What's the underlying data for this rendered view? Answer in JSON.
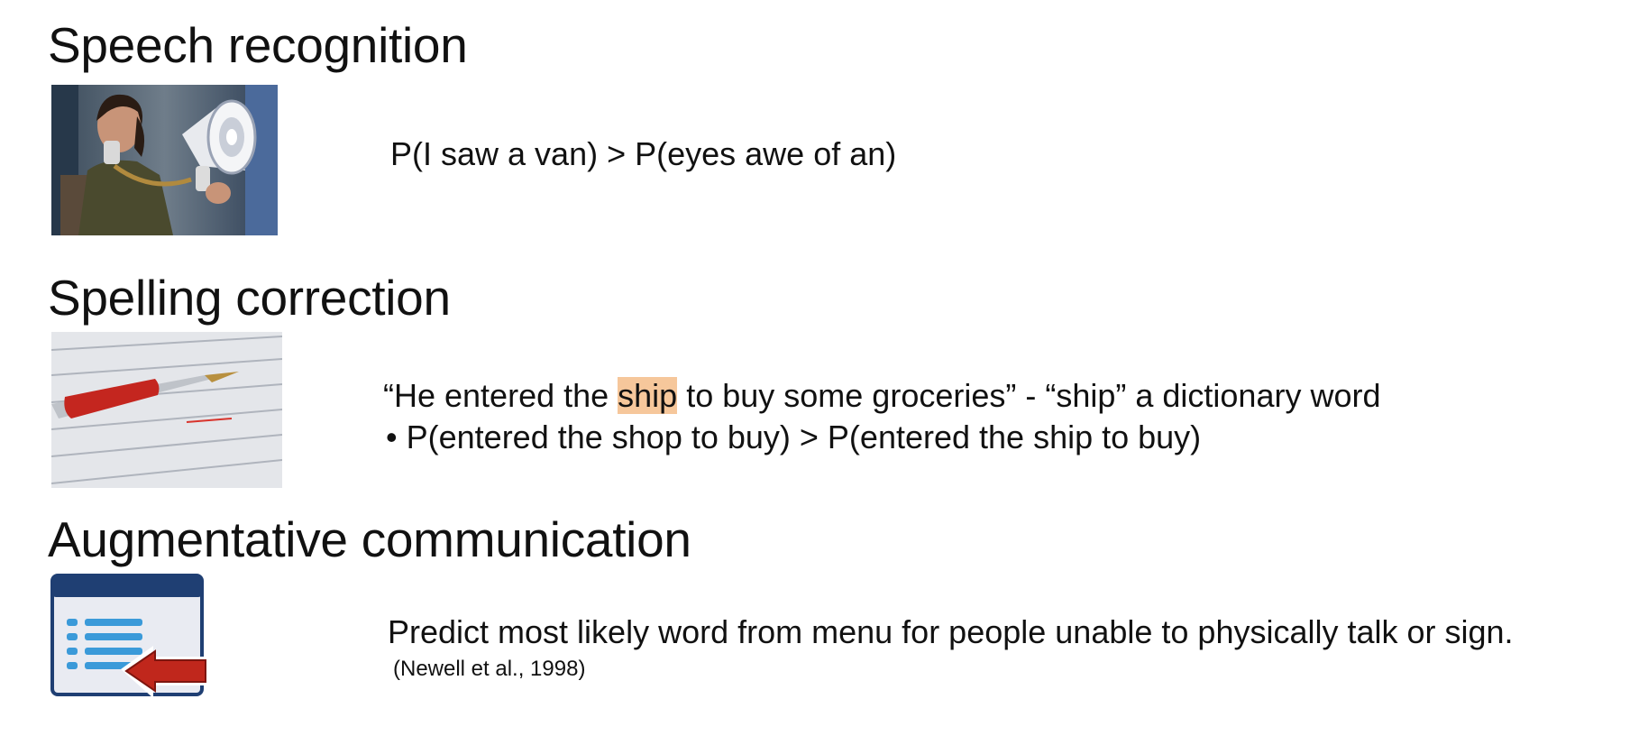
{
  "sections": [
    {
      "heading": "Speech recognition",
      "image_icon": "megaphone-photo",
      "text": "P(I saw a van) > P(eyes awe of an)"
    },
    {
      "heading": "Spelling correction",
      "image_icon": "red-pen-proofreading-photo",
      "line1_before": "“He entered the ",
      "line1_highlight": "ship",
      "line1_after": " to buy some groceries” - “ship” a dictionary word",
      "bullet_char": "•",
      "bullet_text": "P(entered the shop to buy) > P(entered the ship to buy)"
    },
    {
      "heading": "Augmentative communication",
      "image_icon": "menu-list-arrow-icon",
      "text": "Predict most likely word from menu for people unable to physically talk or sign.",
      "citation": "(Newell et al., 1998)"
    }
  ],
  "colors": {
    "highlight": "#f6c79b",
    "icon_frame": "#1f3f73",
    "icon_list": "#3b9ad9",
    "arrow": "#c0271c"
  }
}
